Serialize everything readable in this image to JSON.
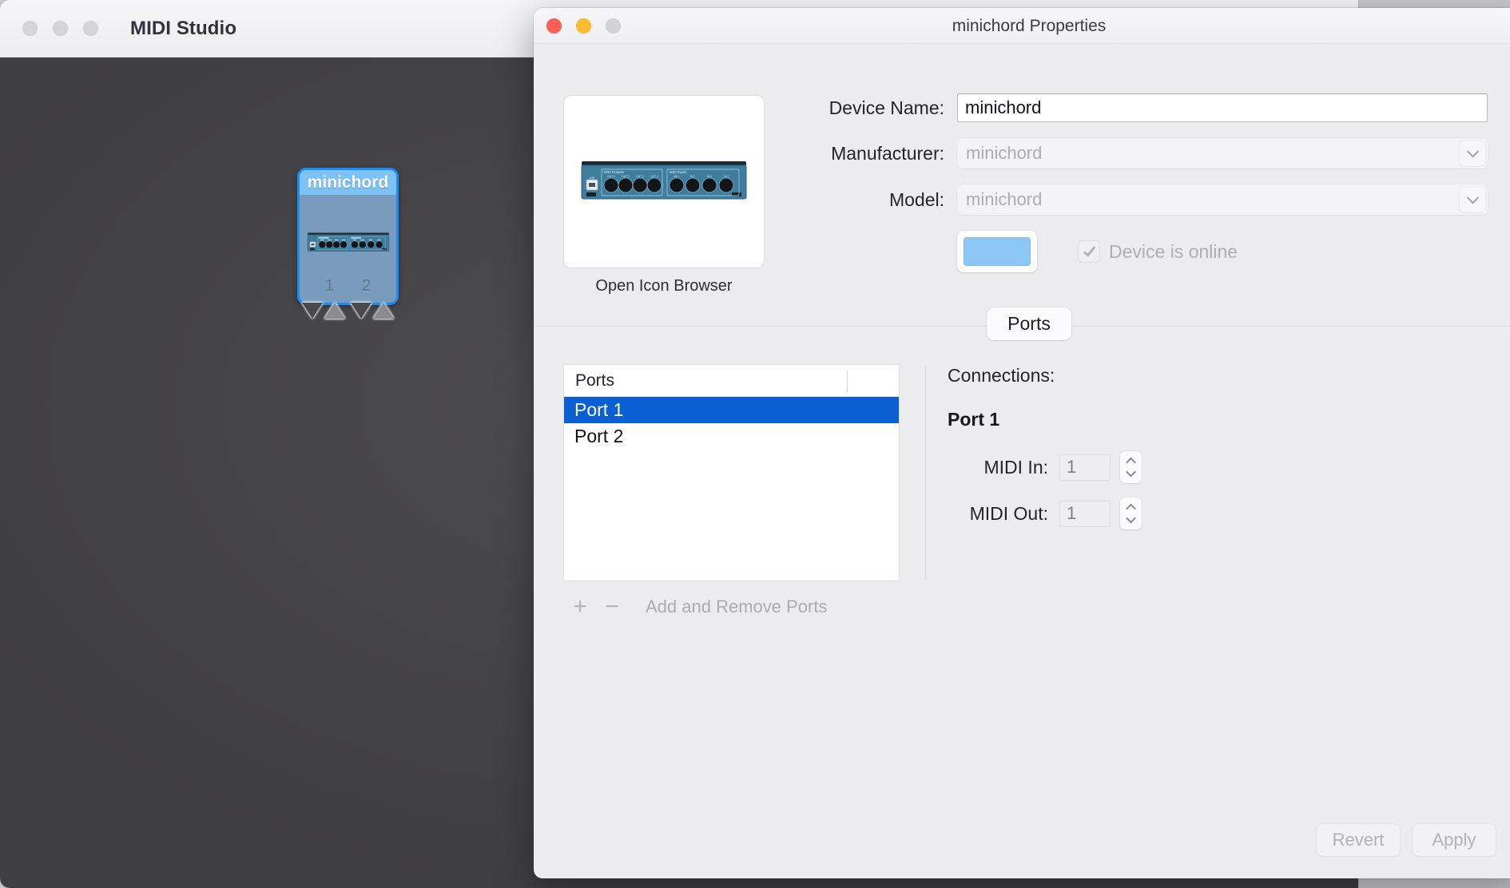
{
  "studio_window": {
    "title": "MIDI Studio",
    "traffic_lights": [
      "close-icon",
      "minimize-icon",
      "zoom-icon"
    ],
    "device_tile": {
      "name": "minichord",
      "icon": "midi-interface-icon",
      "ports": [
        {
          "number": "1",
          "in_arrow": "triangle-down-icon",
          "out_arrow": "triangle-up-icon"
        },
        {
          "number": "2",
          "in_arrow": "triangle-down-icon",
          "out_arrow": "triangle-up-icon"
        }
      ]
    },
    "colors": {
      "canvas": "#454346",
      "tile_fill": "#7ea4c8",
      "tile_border": "#1a8cf5",
      "tile_header": "#7dc2f5"
    }
  },
  "properties_window": {
    "title": "minichord Properties",
    "traffic_lights": [
      "close-icon",
      "minimize-icon",
      "zoom-icon"
    ],
    "icon_panel": {
      "icon": "midi-interface-icon",
      "caption": "Open Icon Browser",
      "icon_labels": {
        "outputs_group": "MIDI Outputs",
        "inputs_group": "MIDI Inputs",
        "outputs": [
          "OUT 1",
          "OUT 2",
          "OUT 3",
          "OUT 4"
        ],
        "inputs": [
          "IN 1",
          "IN 2",
          "IN 3",
          "IN 4"
        ],
        "usb": "USB"
      }
    },
    "form": {
      "device_name": {
        "label": "Device Name:",
        "value": "minichord",
        "placeholder": "Device Name",
        "enabled": true
      },
      "manufacturer": {
        "label": "Manufacturer:",
        "value": "minichord",
        "enabled": false
      },
      "model": {
        "label": "Model:",
        "value": "minichord",
        "enabled": false
      },
      "color_swatch": {
        "name": "device-color-swatch",
        "color": "#8cc6f5"
      },
      "device_online": {
        "label": "Device is online",
        "checked": true,
        "enabled": false
      }
    },
    "tabs": [
      {
        "label": "Ports",
        "selected": true
      }
    ],
    "ports_panel": {
      "column_header": "Ports",
      "rows": [
        {
          "label": "Port 1",
          "selected": true
        },
        {
          "label": "Port 2",
          "selected": false
        }
      ],
      "add_button": "+",
      "remove_button": "−",
      "add_remove_label": "Add and Remove Ports"
    },
    "connections_panel": {
      "title": "Connections:",
      "port_name": "Port 1",
      "midi_in": {
        "label": "MIDI In:",
        "value": "1"
      },
      "midi_out": {
        "label": "MIDI Out:",
        "value": "1"
      }
    },
    "footer": {
      "revert": {
        "label": "Revert",
        "enabled": false
      },
      "apply": {
        "label": "Apply",
        "enabled": false
      }
    }
  }
}
